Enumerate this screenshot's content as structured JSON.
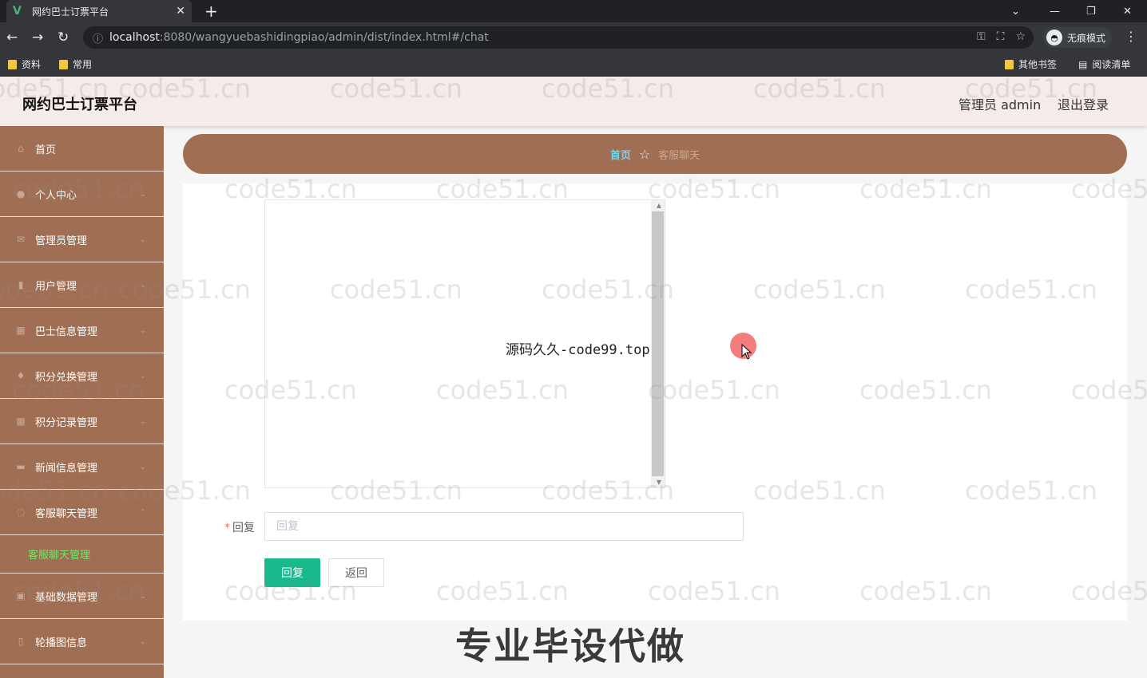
{
  "browser": {
    "tab_title": "网约巴士订票平台",
    "tab_close": "✕",
    "new_tab": "+",
    "url_host": "localhost",
    "url_rest": ":8080/wangyuebashidingpiao/admin/dist/index.html#/chat",
    "incognito_label": "无痕模式",
    "bookmarks": [
      "资料",
      "常用"
    ],
    "other_bookmarks": "其他书签",
    "reading_list": "阅读清单"
  },
  "header": {
    "app_title": "网约巴士订票平台",
    "admin_label": "管理员 admin",
    "logout": "退出登录"
  },
  "sidebar": {
    "items": [
      {
        "label": "首页",
        "icon": "home-icon",
        "glyph": "⌂",
        "arrow": ""
      },
      {
        "label": "个人中心",
        "icon": "user-icon",
        "glyph": "●",
        "arrow": "⌄"
      },
      {
        "label": "管理员管理",
        "icon": "mail-icon",
        "glyph": "✉",
        "arrow": "⌄"
      },
      {
        "label": "用户管理",
        "icon": "user-manage-icon",
        "glyph": "▮",
        "arrow": "⌄"
      },
      {
        "label": "巴士信息管理",
        "icon": "bus-icon",
        "glyph": "▦",
        "arrow": "⌄"
      },
      {
        "label": "积分兑换管理",
        "icon": "exchange-icon",
        "glyph": "♦",
        "arrow": "⌄"
      },
      {
        "label": "积分记录管理",
        "icon": "grid-icon",
        "glyph": "▩",
        "arrow": "⌄"
      },
      {
        "label": "新闻信息管理",
        "icon": "news-icon",
        "glyph": "▬",
        "arrow": "⌄"
      },
      {
        "label": "客服聊天管理",
        "icon": "chat-icon",
        "glyph": "◌",
        "arrow": "⌃"
      }
    ],
    "submenu_label": "客服聊天管理",
    "items_after": [
      {
        "label": "基础数据管理",
        "icon": "data-icon",
        "glyph": "▣",
        "arrow": "⌄"
      },
      {
        "label": "轮播图信息",
        "icon": "carousel-icon",
        "glyph": "▯",
        "arrow": "⌄"
      }
    ]
  },
  "breadcrumb": {
    "home": "首页",
    "star": "☆",
    "current": "客服聊天"
  },
  "form": {
    "reply_label": "回复",
    "required_mark": "*",
    "reply_placeholder": "回复",
    "reply_button": "回复",
    "back_button": "返回"
  },
  "overlay": {
    "center_text": "源码久久-code99.top",
    "promo_text": "专业毕设代做",
    "watermark": "code51.cn"
  },
  "colors": {
    "sidebar_bg": "#a06e52",
    "header_bg": "#f5ecea",
    "primary_button": "#18b98b",
    "submenu_active": "#7ee06a",
    "breadcrumb_home": "#7ad3e9"
  }
}
